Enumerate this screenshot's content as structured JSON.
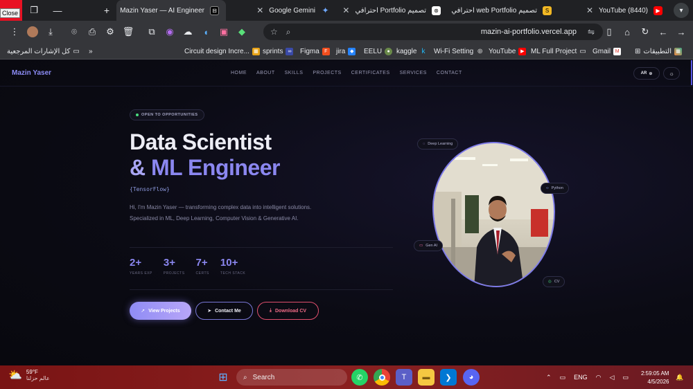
{
  "browser": {
    "close_tooltip": "Close",
    "tabs": [
      {
        "title": "(8440) YouTube",
        "icon": "youtube-icon"
      },
      {
        "title": "تصميم web Portfolio احترافي",
        "icon": "bookmark-icon"
      },
      {
        "title": "تصميم Portfolio احترافي",
        "icon": "chatgpt-icon"
      },
      {
        "title": "Google Gemini",
        "icon": "gemini-icon"
      },
      {
        "title": "Mazin Yaser — AI Engineer",
        "icon": "site-icon"
      }
    ],
    "url": "mazin-ai-portfolio.vercel.app",
    "bookmarks": [
      {
        "label": "التطبيقات"
      },
      {
        "label": "Gmail"
      },
      {
        "label": "ML Full Project"
      },
      {
        "label": "YouTube"
      },
      {
        "label": "Wi-Fi Setting"
      },
      {
        "label": "kaggle"
      },
      {
        "label": "EELU"
      },
      {
        "label": "jira"
      },
      {
        "label": "Figma"
      },
      {
        "label": "sprints"
      },
      {
        "label": "Circuit design Incre..."
      },
      {
        "label": "كل الإشارات المرجعية"
      }
    ]
  },
  "site": {
    "brand": "Mazin Yaser",
    "nav": [
      "HOME",
      "ABOUT",
      "SKILLS",
      "PROJECTS",
      "CERTIFICATES",
      "SERVICES",
      "CONTACT"
    ],
    "lang_label": "AR",
    "badge": "OPEN TO OPPORTUNITIES",
    "title_line1": "Data Scientist",
    "title_amp": "&",
    "title_line2": "ML Engineer",
    "typed": "{TensorFlow}",
    "description": "Hi, I'm Mazin Yaser — transforming complex data into intelligent solutions. Specialized in ML, Deep Learning, Computer Vision & Generative AI.",
    "stats": [
      {
        "value": "2+",
        "label": "YEARS EXP"
      },
      {
        "value": "3+",
        "label": "PROJECTS"
      },
      {
        "value": "7+",
        "label": "CERTS"
      },
      {
        "value": "10+",
        "label": "TECH STACK"
      }
    ],
    "buttons": {
      "view_projects": "View Projects",
      "contact": "Contact Me",
      "download_cv": "Download CV"
    },
    "floating_tags": {
      "deep_learning": "Deep Learning",
      "python": "Python",
      "gen_ai": "Gen AI",
      "cv": "CV"
    }
  },
  "taskbar": {
    "temperature": "59°F",
    "weather_sub": "عالم حزلنا",
    "search_placeholder": "Search",
    "lang": "ENG",
    "time": "2:59:05 AM",
    "date": "4/5/2026"
  },
  "colors": {
    "accent": "#8b87f0",
    "cv_red": "#e2506e",
    "open_dot": "#4ade80"
  }
}
